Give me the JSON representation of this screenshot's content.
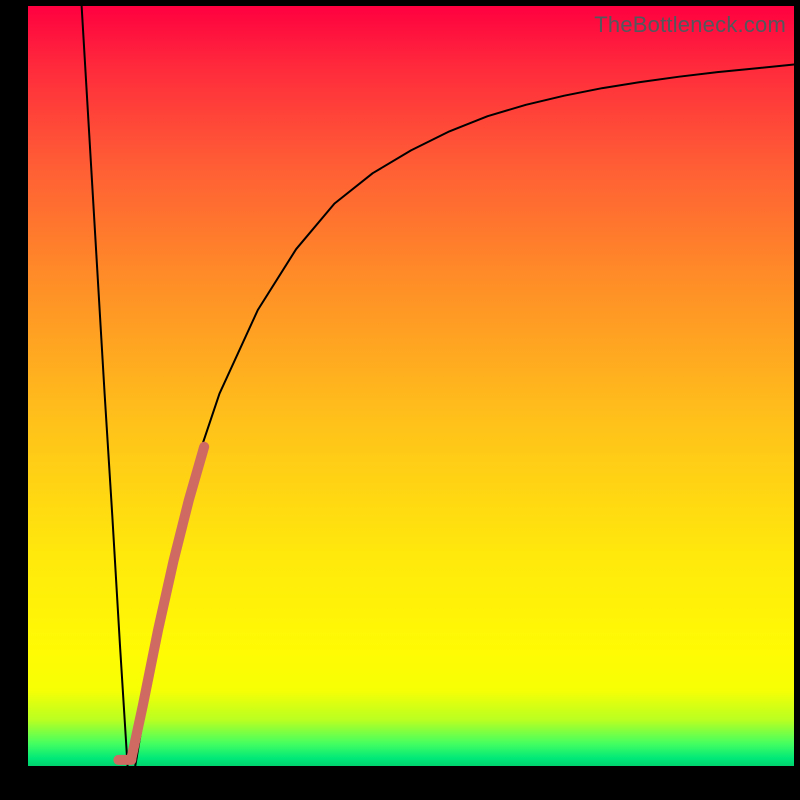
{
  "watermark": "TheBottleneck.com",
  "chart_data": {
    "type": "line",
    "title": "",
    "xlabel": "",
    "ylabel": "",
    "xlim": [
      0,
      100
    ],
    "ylim": [
      0,
      100
    ],
    "grid": false,
    "legend": false,
    "series": [
      {
        "name": "curve-left-descent",
        "color": "#000000",
        "stroke_width": 2,
        "x": [
          7,
          8,
          9,
          10,
          11,
          12,
          13
        ],
        "values": [
          100,
          83,
          66,
          49,
          33,
          16,
          0
        ]
      },
      {
        "name": "curve-right-rise",
        "color": "#000000",
        "stroke_width": 2,
        "x": [
          14,
          16,
          18,
          20,
          22,
          25,
          30,
          35,
          40,
          45,
          50,
          55,
          60,
          65,
          70,
          75,
          80,
          85,
          90,
          95,
          100
        ],
        "values": [
          0,
          12,
          23,
          32,
          40,
          49,
          60,
          68,
          74,
          78,
          81,
          83.5,
          85.5,
          87,
          88.2,
          89.2,
          90,
          90.7,
          91.3,
          91.8,
          92.3
        ]
      },
      {
        "name": "highlight-segment",
        "color": "#cf6a63",
        "stroke_width": 10,
        "x": [
          13.5,
          15,
          17,
          19,
          21,
          23
        ],
        "values": [
          1,
          8,
          18,
          27,
          35,
          42
        ]
      },
      {
        "name": "highlight-base",
        "color": "#cf6a63",
        "stroke_width": 10,
        "x": [
          11.8,
          13.5
        ],
        "values": [
          0.8,
          0.8
        ]
      }
    ]
  }
}
